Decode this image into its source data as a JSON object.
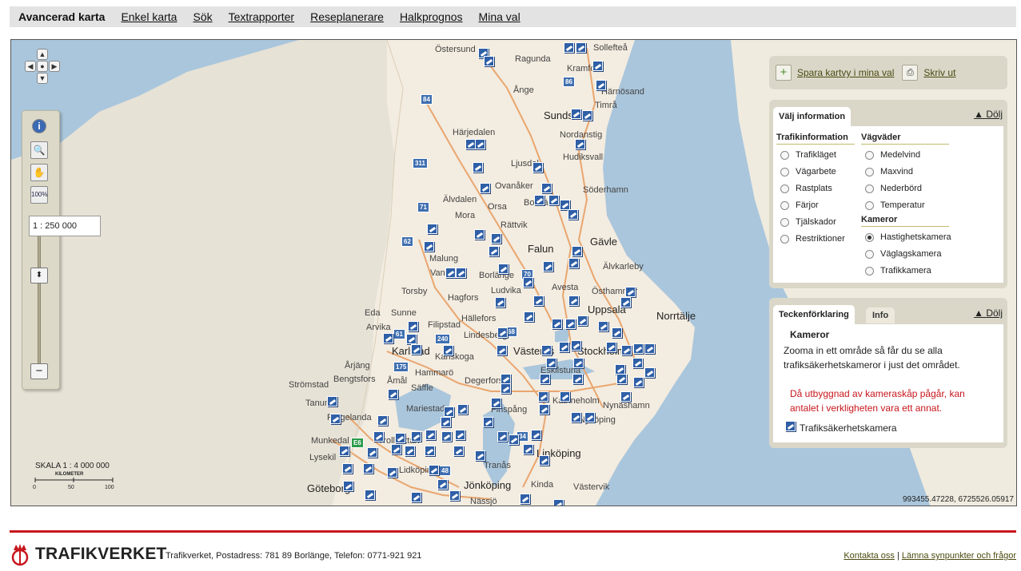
{
  "nav": {
    "items": [
      "Avancerad karta",
      "Enkel karta",
      "Sök",
      "Textrapporter",
      "Reseplanerare",
      "Halkprognos",
      "Mina val"
    ]
  },
  "map": {
    "scale_box": "1 : 250 000",
    "scale_label": "SKALA 1 : 4 000 000",
    "scale_unit": "KILOMETER",
    "scale_ticks": [
      "0",
      "50",
      "100"
    ],
    "coordinates": "993455.47228, 6725526.05917",
    "places": [
      {
        "name": "Östersund",
        "big": false
      },
      {
        "name": "Sollefteå",
        "big": false
      },
      {
        "name": "Ragunda",
        "big": false
      },
      {
        "name": "Kramfors",
        "big": false
      },
      {
        "name": "Ånge",
        "big": false
      },
      {
        "name": "Härnösand",
        "big": false
      },
      {
        "name": "Timrå",
        "big": false
      },
      {
        "name": "Sundsvall",
        "big": true
      },
      {
        "name": "Härjedalen",
        "big": false
      },
      {
        "name": "Nordanstig",
        "big": false
      },
      {
        "name": "Hudiksvall",
        "big": false
      },
      {
        "name": "Ljusdal",
        "big": false
      },
      {
        "name": "Ovanåker",
        "big": false
      },
      {
        "name": "Söderhamn",
        "big": false
      },
      {
        "name": "Älvdalen",
        "big": false
      },
      {
        "name": "Bollnäs",
        "big": false
      },
      {
        "name": "Mora",
        "big": false
      },
      {
        "name": "Orsa",
        "big": false
      },
      {
        "name": "Rättvik",
        "big": false
      },
      {
        "name": "Gävle",
        "big": true
      },
      {
        "name": "Falun",
        "big": true
      },
      {
        "name": "Malung",
        "big": false
      },
      {
        "name": "Borlänge",
        "big": false
      },
      {
        "name": "Älvkarleby",
        "big": false
      },
      {
        "name": "Vansbro",
        "big": false
      },
      {
        "name": "Avesta",
        "big": false
      },
      {
        "name": "Ludvika",
        "big": false
      },
      {
        "name": "Östhammar",
        "big": false
      },
      {
        "name": "Torsby",
        "big": false
      },
      {
        "name": "Hagfors",
        "big": false
      },
      {
        "name": "Uppsala",
        "big": true
      },
      {
        "name": "Eda",
        "big": false
      },
      {
        "name": "Sunne",
        "big": false
      },
      {
        "name": "Hällefors",
        "big": false
      },
      {
        "name": "Norrtälje",
        "big": true
      },
      {
        "name": "Arvika",
        "big": false
      },
      {
        "name": "Filipstad",
        "big": false
      },
      {
        "name": "Lindesberg",
        "big": false
      },
      {
        "name": "Karlstad",
        "big": true
      },
      {
        "name": "Karlskoga",
        "big": false
      },
      {
        "name": "Västerås",
        "big": true
      },
      {
        "name": "Stockholm",
        "big": true
      },
      {
        "name": "Årjäng",
        "big": false
      },
      {
        "name": "Hammarö",
        "big": false
      },
      {
        "name": "Eskilstuna",
        "big": false
      },
      {
        "name": "Bengtsfors",
        "big": false
      },
      {
        "name": "Åmål",
        "big": false
      },
      {
        "name": "Degerfors",
        "big": false
      },
      {
        "name": "Strömstad",
        "big": false
      },
      {
        "name": "Säffle",
        "big": false
      },
      {
        "name": "Katrineholm",
        "big": false
      },
      {
        "name": "Tanum",
        "big": false
      },
      {
        "name": "Mariestad",
        "big": false
      },
      {
        "name": "Nynäshamn",
        "big": false
      },
      {
        "name": "Färgelanda",
        "big": false
      },
      {
        "name": "Finspång",
        "big": false
      },
      {
        "name": "Nyköping",
        "big": false
      },
      {
        "name": "Munkedal",
        "big": false
      },
      {
        "name": "Trollhättan",
        "big": false
      },
      {
        "name": "Lidköping",
        "big": false
      },
      {
        "name": "Linköping",
        "big": true
      },
      {
        "name": "Lysekil",
        "big": false
      },
      {
        "name": "Tranås",
        "big": false
      },
      {
        "name": "Jönköping",
        "big": true
      },
      {
        "name": "Göteborg",
        "big": true
      },
      {
        "name": "Kinda",
        "big": false
      },
      {
        "name": "Västervik",
        "big": false
      },
      {
        "name": "Nässjö",
        "big": false
      }
    ],
    "shields": [
      "84",
      "86",
      "311",
      "71",
      "62",
      "70",
      "61",
      "240",
      "68",
      "175",
      "34",
      "48",
      "E6"
    ]
  },
  "save_bar": {
    "save_label": "Spara kartvy i mina val",
    "print_label": "Skriv ut"
  },
  "info_panel": {
    "tab_label": "Välj information",
    "hide_label": "Dölj",
    "traffic_heading": "Trafikinformation",
    "traffic_options": [
      "Trafikläget",
      "Vägarbete",
      "Rastplats",
      "Färjor",
      "Tjälskador",
      "Restriktioner"
    ],
    "weather_heading": "Vägväder",
    "weather_options": [
      "Medelvind",
      "Maxvind",
      "Nederbörd",
      "Temperatur"
    ],
    "camera_heading": "Kameror",
    "camera_options": [
      "Hastighetskamera",
      "Väglagskamera",
      "Trafikkamera"
    ],
    "selected": "Hastighetskamera"
  },
  "legend_panel": {
    "tab_active": "Teckenförklaring",
    "tab_inactive": "Info",
    "hide_label": "Dölj",
    "title": "Kameror",
    "text": "Zooma in ett område så får du se alla trafiksäkerhetskameror i just det området.",
    "warning": "Då utbyggnad av kameraskåp pågår, kan antalet i verkligheten vara ett annat.",
    "item_label": "Trafiksäkerhetskamera"
  },
  "footer": {
    "logo_text": "TRAFIKVERKET",
    "address": "Trafikverket, Postadress: 781 89 Borlänge, Telefon: 0771-921 921",
    "link1": "Kontakta oss",
    "separator": "|",
    "link2": "Lämna synpunkter och frågor"
  },
  "colors": {
    "sea": "#aac6dc",
    "land": "#f3ece0",
    "road": "#e9a66f",
    "camera": "#2f5fa6",
    "brand_red": "#c8161d"
  }
}
